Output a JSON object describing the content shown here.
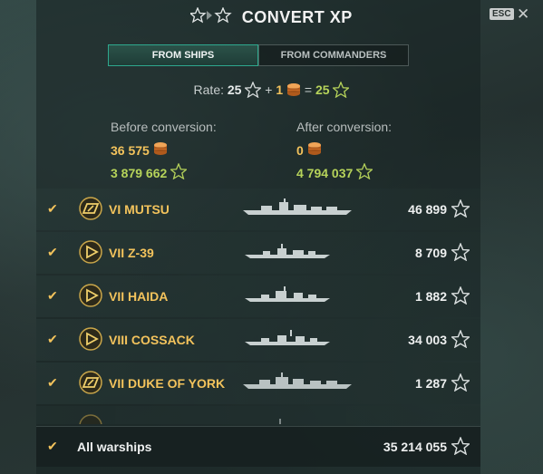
{
  "dialog": {
    "title": "CONVERT XP",
    "esc_label": "ESC",
    "close_symbol": "✕"
  },
  "tabs": [
    {
      "label": "FROM SHIPS",
      "active": true
    },
    {
      "label": "FROM COMMANDERS",
      "active": false
    }
  ],
  "rate": {
    "prefix": "Rate:",
    "xp_amount": "25",
    "plus": "+",
    "doubloons": "1",
    "equals": "=",
    "free_xp": "25"
  },
  "before": {
    "heading": "Before conversion:",
    "doubloons": "36 575",
    "xp": "3 879 662"
  },
  "after": {
    "heading": "After conversion:",
    "doubloons": "0",
    "xp": "4 794 037"
  },
  "ships": [
    {
      "name": "VI MUTSU",
      "xp": "46 899",
      "emblem": "battleship-emblem-icon",
      "checked": true,
      "silhouette": "battleship"
    },
    {
      "name": "VII Z-39",
      "xp": "8 709",
      "emblem": "destroyer-emblem-icon",
      "checked": true,
      "silhouette": "destroyer"
    },
    {
      "name": "VII HAIDA",
      "xp": "1 882",
      "emblem": "destroyer-emblem-icon",
      "checked": true,
      "silhouette": "destroyer"
    },
    {
      "name": "VIII COSSACK",
      "xp": "34 003",
      "emblem": "destroyer-emblem-icon",
      "checked": true,
      "silhouette": "destroyer"
    },
    {
      "name": "VII DUKE OF YORK",
      "xp": "1 287",
      "emblem": "battleship-emblem-icon",
      "checked": true,
      "silhouette": "battleship"
    }
  ],
  "footer": {
    "label": "All warships",
    "xp": "35 214 055",
    "checked": true
  },
  "colors": {
    "accent_gold": "#f3c35c",
    "accent_green": "#b6d35a",
    "tab_active": "#2ea88e"
  }
}
